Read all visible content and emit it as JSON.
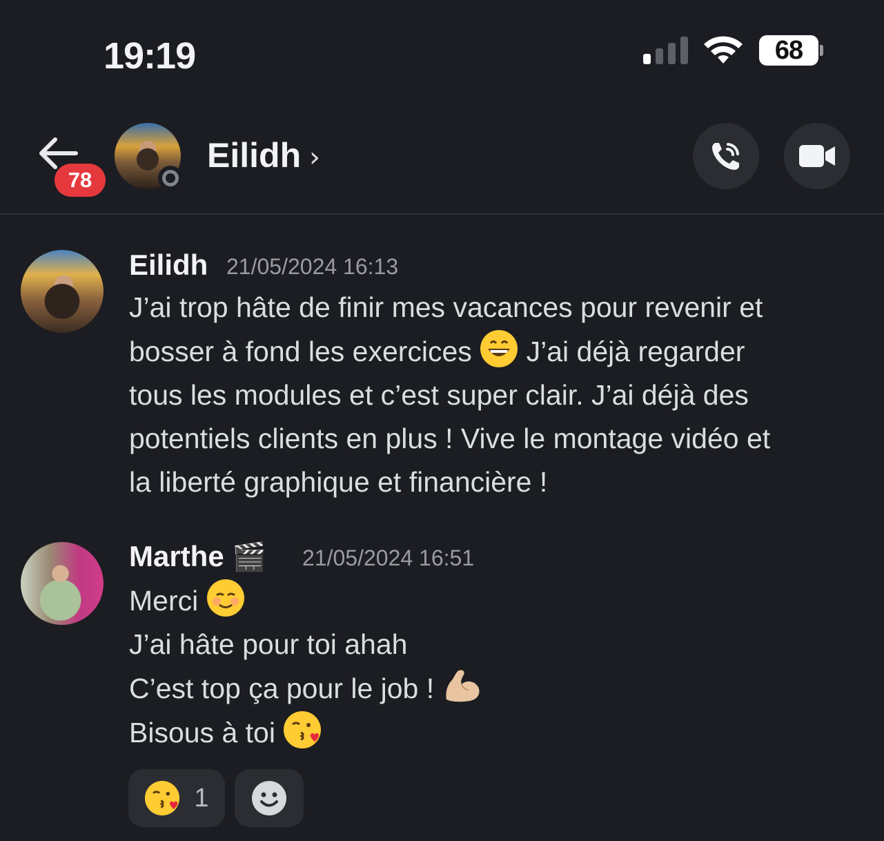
{
  "status_bar": {
    "time": "19:19",
    "battery": "68"
  },
  "header": {
    "unread_count": "78",
    "contact_name": "Eilidh",
    "chevron": "›",
    "icons": [
      "back-arrow-icon",
      "phone-call-icon",
      "video-camera-icon"
    ]
  },
  "messages": [
    {
      "author": "Eilidh",
      "timestamp": "21/05/2024 16:13",
      "lines": [
        "J’ai trop hâte de finir mes vacances pour revenir et",
        "bosser à fond les exercices",
        "J’ai déjà regarder",
        "tous les modules et c’est super clair. J’ai déjà des",
        "potentiels clients en plus ! Vive le montage vidéo et",
        "la liberté graphique et financière !"
      ],
      "emoji": "grinning-face-icon"
    },
    {
      "author": "Marthe",
      "author_badge": "🎬",
      "timestamp": "21/05/2024 16:51",
      "lines": [
        "Merci",
        "J’ai hâte pour toi ahah",
        "C’est top ça pour le job !",
        "Bisous à toi"
      ],
      "emojis": [
        "smiling-face-icon",
        "flexed-biceps-icon",
        "face-blowing-kiss-icon"
      ]
    }
  ],
  "reactions": [
    {
      "emoji": "face-blowing-kiss-icon",
      "count": "1"
    },
    {
      "emoji": "add-reaction-icon"
    }
  ],
  "colors": {
    "background": "#1c1d22",
    "badge": "#e5393e",
    "button_bg": "#2b2d33",
    "timestamp": "#9b9ca3"
  }
}
